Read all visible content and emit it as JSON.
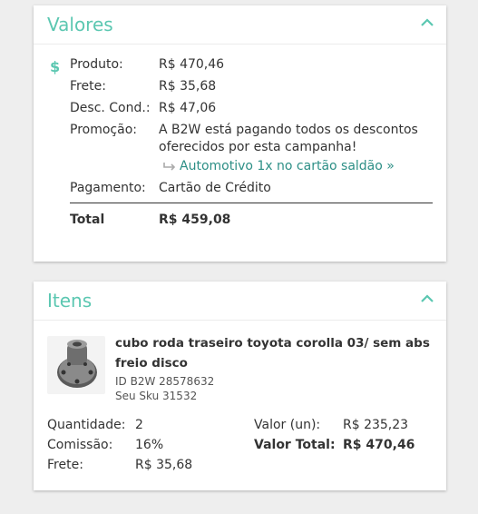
{
  "valores": {
    "title": "Valores",
    "currency_icon": "dollar-icon",
    "rows": {
      "produto": {
        "label": "Produto:",
        "value": "R$ 470,46"
      },
      "frete": {
        "label": "Frete:",
        "value": "R$ 35,68"
      },
      "desc_cond": {
        "label": "Desc. Cond.:",
        "value": "R$ 47,06"
      },
      "promocao": {
        "label": "Promoção:",
        "value_line1": "A B2W está pagando todos os descontos",
        "value_line2": "oferecidos por esta campanha!",
        "link_icon": "arrow-return-icon",
        "link": "Automotivo 1x no cartão saldão »"
      },
      "pagamento": {
        "label": "Pagamento:",
        "value": "Cartão de Crédito"
      },
      "total": {
        "label": "Total",
        "value": "R$ 459,08"
      }
    }
  },
  "itens": {
    "title": "Itens",
    "item": {
      "name_line1": "cubo roda traseiro toyota corolla 03/ sem abs",
      "name_line2": "freio disco",
      "id": "ID B2W 28578632",
      "sku": "Seu Sku 31532",
      "quantidade_label": "Quantidade:",
      "quantidade": "2",
      "comissao_label": "Comissão:",
      "comissao": "16%",
      "frete_label": "Frete:",
      "frete": "R$ 35,68",
      "valor_un_label": "Valor (un):",
      "valor_un": "R$ 235,23",
      "valor_total_label": "Valor Total:",
      "valor_total": "R$ 470,46"
    }
  },
  "colors": {
    "accent": "#5bc7b1",
    "link": "#2d8f86",
    "background": "#eeeeee"
  }
}
